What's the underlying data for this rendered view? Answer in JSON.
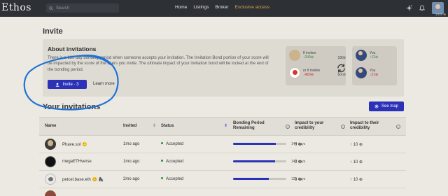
{
  "header": {
    "logo": "Ethos",
    "search_placeholder": "Search",
    "nav": [
      "Home",
      "Listings",
      "Broker",
      "Exclusive access"
    ],
    "user_score": "1415 ⊕"
  },
  "page": {
    "title": "Invite"
  },
  "about": {
    "heading": "About invitations",
    "body": "There is a 180 day bonding period when someone accepts your invitation. The Invitation Bond portion of your score will be impacted by the score of the users you invite. The ultimate impact of your invitation bond will be locked at the end of the bonding period.",
    "invite_button": "Invite · 3",
    "learn_more": "Learn more",
    "bond": {
      "left_top_label": "If invitee",
      "left_top_value": "↑240⊕",
      "left_bottom_label": "or if invitee",
      "left_bottom_value": "↓420⊕",
      "mid_top": "180d",
      "mid_bottom": "bond",
      "right_top_label": "You",
      "right_top_value": "↑12⊕",
      "right_bottom_label": "You",
      "right_bottom_value": "↓21⊕"
    }
  },
  "invitations": {
    "title": "Your invitations",
    "see_map": "See map",
    "columns": {
      "name": "Name",
      "invited": "Invited",
      "status": "Status",
      "bonding": "Bonding Period Remaining",
      "impact_you": "Impact to your credibility",
      "impact_them": "Impact to their credibility"
    },
    "rows": [
      {
        "name": "Phave.sol",
        "emoji": "🙂",
        "invited": "1mo ago",
        "status": "Accepted",
        "progress": 0.8,
        "days": "144 days",
        "impact_you": "0 ⊕",
        "impact_them": "↑ 10 ⊕"
      },
      {
        "name": "megaETHverse",
        "emoji": "",
        "invited": "1mo ago",
        "status": "Accepted",
        "progress": 0.79,
        "days": "143 days",
        "impact_you": "0 ⊕",
        "impact_them": "↑ 10 ⊕"
      },
      {
        "name": "petcel.base.eth",
        "emoji": "😊 🦍",
        "invited": "2mo ago",
        "status": "Accepted",
        "progress": 0.67,
        "days": "121 days",
        "impact_you": "0 ⊕",
        "impact_them": "↑ 10 ⊕"
      }
    ]
  },
  "colors": {
    "accent": "#2c32b8",
    "header_bg": "#2d3035",
    "page_bg": "#ebe9e2",
    "annotation": "#1e73d6"
  }
}
